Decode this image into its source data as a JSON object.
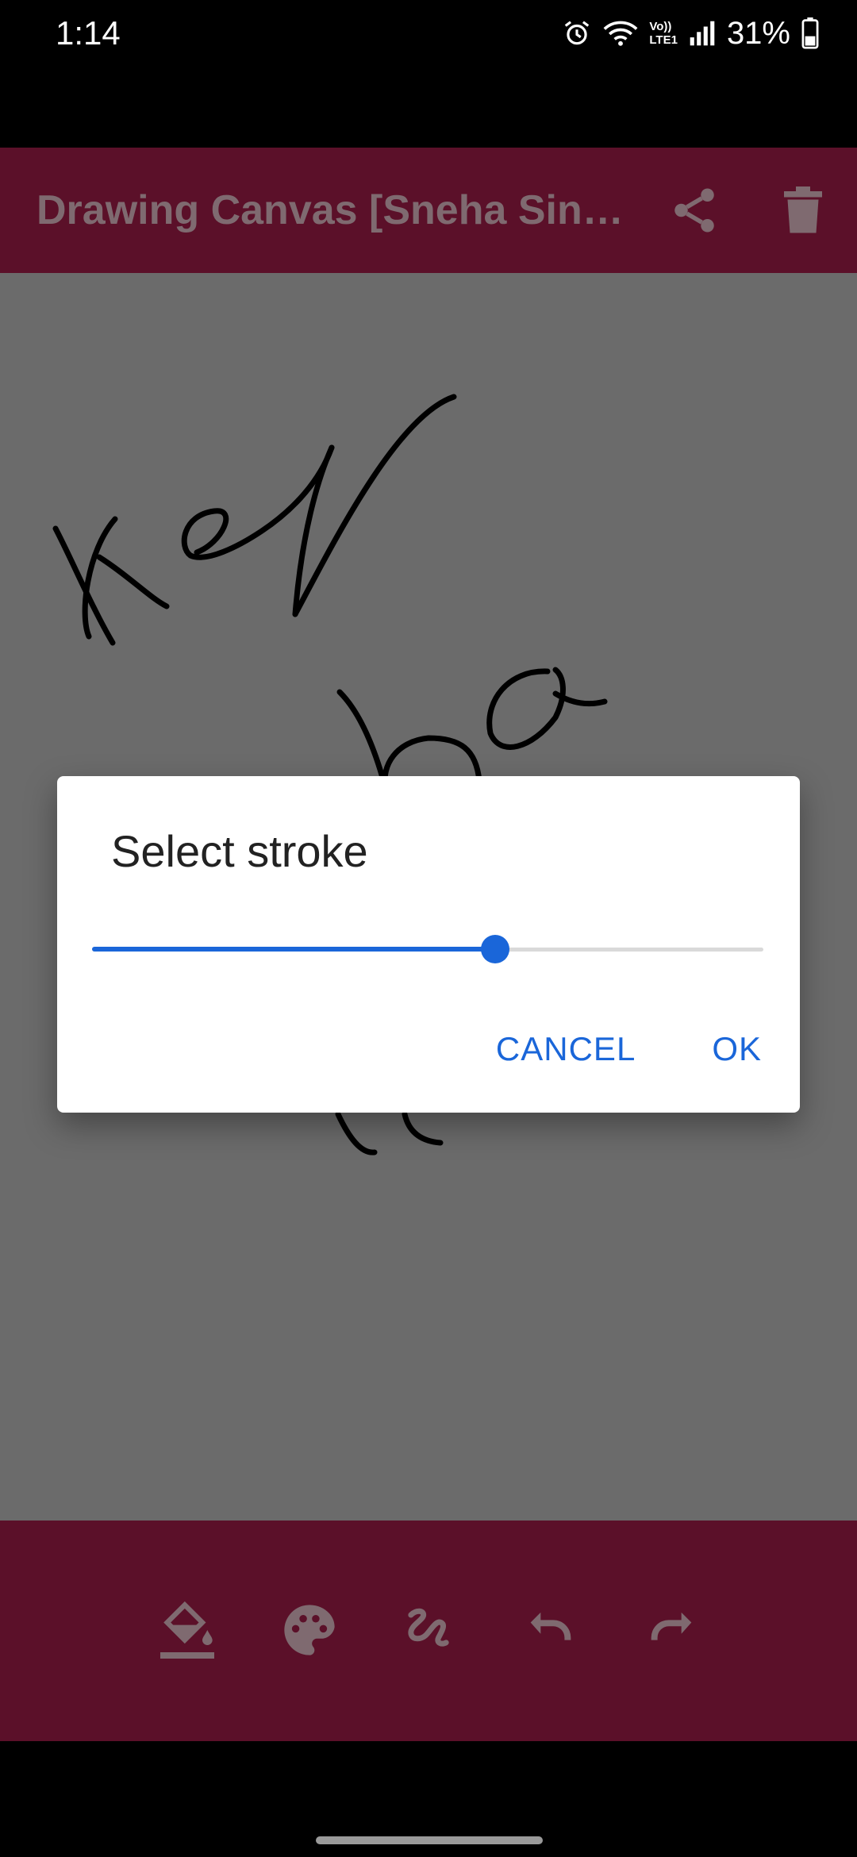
{
  "status_bar": {
    "time": "1:14",
    "battery_percent": "31%",
    "icons": [
      "alarm-icon",
      "wifi-icon",
      "volte-lte-icon",
      "signal-icon",
      "battery-icon"
    ],
    "volte_label": "Vo))",
    "lte_label": "LTE1"
  },
  "app_bar": {
    "title": "Drawing Canvas [Sneha Sin…",
    "actions": [
      "share-icon",
      "delete-icon"
    ],
    "background": "#5b1029"
  },
  "canvas": {
    "background": "#6b6b6b",
    "stroke_color": "#000000"
  },
  "dialog": {
    "title": "Select stroke",
    "slider_value_fraction": 0.6,
    "cancel_label": "CANCEL",
    "ok_label": "OK",
    "accent": "#1a66d9"
  },
  "toolbar": {
    "tools": [
      "fill-bucket-icon",
      "palette-icon",
      "stroke-icon",
      "undo-icon",
      "redo-icon"
    ],
    "selected_tool": "fill-bucket-icon"
  }
}
